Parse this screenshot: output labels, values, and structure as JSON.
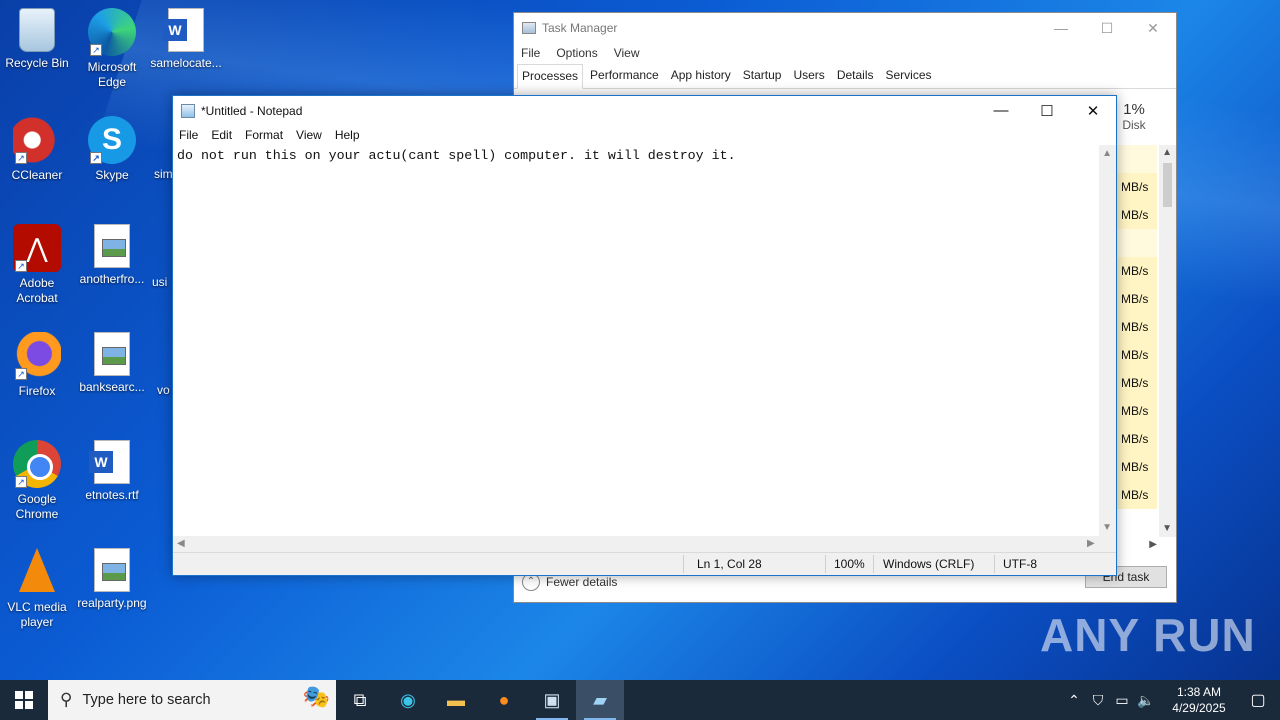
{
  "desktop": {
    "icons": [
      {
        "label": "Recycle Bin"
      },
      {
        "label": "Microsoft Edge"
      },
      {
        "label": "samelocate..."
      },
      {
        "label": "CCleaner"
      },
      {
        "label": "Skype"
      },
      {
        "label": "Adobe Acrobat"
      },
      {
        "label": "anotherfro..."
      },
      {
        "label": "Firefox"
      },
      {
        "label": "banksearc..."
      },
      {
        "label": "Google Chrome"
      },
      {
        "label": "etnotes.rtf"
      },
      {
        "label": "VLC media player"
      },
      {
        "label": "realparty.png"
      }
    ],
    "partial_labels": [
      "sim",
      "usi",
      "vo"
    ],
    "watermark": "ANY RUN"
  },
  "task_manager": {
    "title": "Task Manager",
    "menu": [
      "File",
      "Options",
      "View"
    ],
    "tabs": [
      "Processes",
      "Performance",
      "App history",
      "Startup",
      "Users",
      "Details",
      "Services"
    ],
    "active_tab": "Processes",
    "disk_percent": "1%",
    "disk_label": "Disk",
    "disk_cells": [
      "MB/s",
      "MB/s",
      "",
      "MB/s",
      "MB/s",
      "MB/s",
      "MB/s",
      "MB/s",
      "MB/s",
      "MB/s",
      "MB/s",
      "MB/s"
    ],
    "fewer_details": "Fewer details",
    "end_task": "End task"
  },
  "notepad": {
    "title": "*Untitled - Notepad",
    "menu": [
      "File",
      "Edit",
      "Format",
      "View",
      "Help"
    ],
    "content": "do not run this on your actu(cant spell) computer. it will destroy it.",
    "status": {
      "position": "Ln 1, Col 28",
      "zoom": "100%",
      "line_ending": "Windows (CRLF)",
      "encoding": "UTF-8"
    }
  },
  "taskbar": {
    "search_placeholder": "Type here to search",
    "time": "1:38 AM",
    "date": "4/29/2025"
  }
}
